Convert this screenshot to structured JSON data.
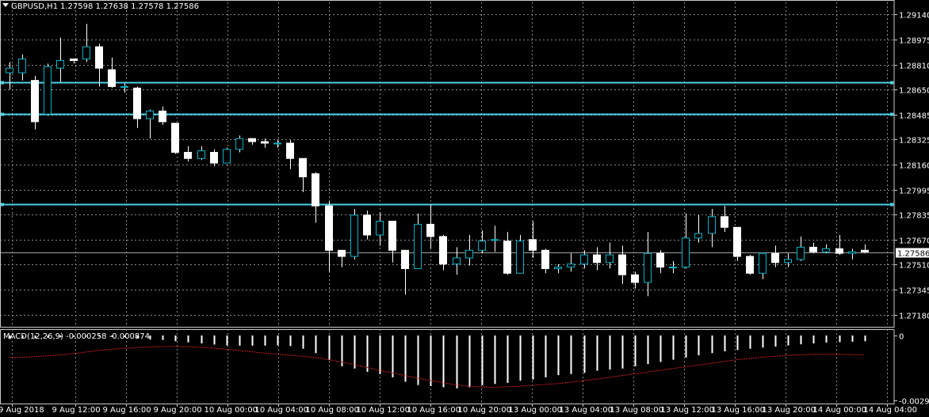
{
  "main_header": {
    "symbol_tf": "GBPUSD,H1",
    "ohlc": "1.27598 1.27638 1.27578 1.27586"
  },
  "macd_header": {
    "label": "MACD(12,26,9) -0.000258 -0.000874"
  },
  "current_price_label": "1.27586",
  "colors": {
    "background": "#000000",
    "bull_outline": "#00b4c8",
    "bear_fill": "#ffffff",
    "wick": "#ffffff",
    "hline": "#4cd2e6",
    "macd_hist": "#ffffff",
    "macd_signal": "#c81e1e",
    "grid": "#8a8a8a",
    "price_tag_bg": "#ffffff"
  },
  "chart_data": [
    {
      "type": "candlestick",
      "title": "GBPUSD,H1",
      "ylim": [
        1.271,
        1.2922
      ],
      "y_ticks": [
        "1.29140",
        "1.28975",
        "1.28810",
        "1.28650",
        "1.28485",
        "1.28325",
        "1.28160",
        "1.27995",
        "1.27835",
        "1.27670",
        "1.27510",
        "1.27345",
        "1.27180"
      ],
      "x_ticks": [
        "9 Aug 2018",
        "9 Aug 12:00",
        "9 Aug 16:00",
        "9 Aug 20:00",
        "10 Aug 00:00",
        "10 Aug 04:00",
        "10 Aug 08:00",
        "10 Aug 12:00",
        "10 Aug 16:00",
        "10 Aug 20:00",
        "13 Aug 00:00",
        "13 Aug 04:00",
        "13 Aug 08:00",
        "13 Aug 12:00",
        "13 Aug 16:00",
        "13 Aug 20:00",
        "14 Aug 00:00",
        "14 Aug 04:00"
      ],
      "horizontal_levels": [
        1.287,
        1.2849,
        1.279
      ],
      "current_price": 1.27586,
      "candles": [
        [
          1.2876,
          1.2879,
          1.2865,
          1.2883
        ],
        [
          1.2876,
          1.2885,
          1.2871,
          1.2888
        ],
        [
          1.2871,
          1.2844,
          1.2839,
          1.2874
        ],
        [
          1.2849,
          1.288,
          1.2848,
          1.2882
        ],
        [
          1.2879,
          1.2884,
          1.287,
          1.2899
        ],
        [
          1.2885,
          1.2884,
          1.2882,
          1.2885
        ],
        [
          1.2885,
          1.2893,
          1.2883,
          1.2908
        ],
        [
          1.2893,
          1.2879,
          1.2867,
          1.2895
        ],
        [
          1.2878,
          1.2867,
          1.2866,
          1.2886
        ],
        [
          1.2867,
          1.2867,
          1.2863,
          1.2869
        ],
        [
          1.2866,
          1.2846,
          1.284,
          1.2867
        ],
        [
          1.2846,
          1.2851,
          1.2833,
          1.2852
        ],
        [
          1.2851,
          1.2844,
          1.2842,
          1.2854
        ],
        [
          1.2843,
          1.2824,
          1.2823,
          1.2843
        ],
        [
          1.2824,
          1.282,
          1.2818,
          1.2828
        ],
        [
          1.282,
          1.2825,
          1.2819,
          1.2828
        ],
        [
          1.2824,
          1.2817,
          1.2815,
          1.2826
        ],
        [
          1.2817,
          1.2826,
          1.2817,
          1.2827
        ],
        [
          1.2826,
          1.2833,
          1.2824,
          1.2835
        ],
        [
          1.2833,
          1.2831,
          1.2829,
          1.2833
        ],
        [
          1.2831,
          1.283,
          1.2827,
          1.2833
        ],
        [
          1.283,
          1.283,
          1.2827,
          1.2832
        ],
        [
          1.283,
          1.282,
          1.2813,
          1.2832
        ],
        [
          1.282,
          1.2808,
          1.2798,
          1.282
        ],
        [
          1.281,
          1.2789,
          1.2778,
          1.2811
        ],
        [
          1.2789,
          1.276,
          1.2746,
          1.2792
        ],
        [
          1.276,
          1.2756,
          1.2749,
          1.276
        ],
        [
          1.2756,
          1.2783,
          1.2754,
          1.2787
        ],
        [
          1.2783,
          1.277,
          1.2767,
          1.2786
        ],
        [
          1.277,
          1.2779,
          1.2763,
          1.2785
        ],
        [
          1.2779,
          1.276,
          1.2752,
          1.2779
        ],
        [
          1.276,
          1.2748,
          1.2731,
          1.276
        ],
        [
          1.2748,
          1.2777,
          1.2748,
          1.2784
        ],
        [
          1.2777,
          1.2769,
          1.2761,
          1.279
        ],
        [
          1.2769,
          1.2751,
          1.2747,
          1.277
        ],
        [
          1.2751,
          1.2755,
          1.2744,
          1.2762
        ],
        [
          1.2755,
          1.276,
          1.275,
          1.277
        ],
        [
          1.276,
          1.2766,
          1.2758,
          1.2773
        ],
        [
          1.2767,
          1.2767,
          1.2759,
          1.2776
        ],
        [
          1.2766,
          1.2745,
          1.2744,
          1.2772
        ],
        [
          1.2745,
          1.2766,
          1.2745,
          1.277
        ],
        [
          1.2767,
          1.276,
          1.2755,
          1.2779
        ],
        [
          1.276,
          1.2748,
          1.2745,
          1.2761
        ],
        [
          1.2748,
          1.2749,
          1.2745,
          1.2751
        ],
        [
          1.2749,
          1.2751,
          1.2746,
          1.2758
        ],
        [
          1.2751,
          1.2757,
          1.2748,
          1.276
        ],
        [
          1.2757,
          1.2752,
          1.2747,
          1.2762
        ],
        [
          1.2752,
          1.2757,
          1.2748,
          1.2765
        ],
        [
          1.2757,
          1.2744,
          1.2738,
          1.2763
        ],
        [
          1.2744,
          1.2739,
          1.2735,
          1.2746
        ],
        [
          1.2739,
          1.2758,
          1.273,
          1.2772
        ],
        [
          1.2758,
          1.2749,
          1.2745,
          1.276
        ],
        [
          1.2749,
          1.2749,
          1.2745,
          1.2753
        ],
        [
          1.2749,
          1.2768,
          1.2748,
          1.2784
        ],
        [
          1.2768,
          1.2771,
          1.2765,
          1.2783
        ],
        [
          1.2771,
          1.2782,
          1.2762,
          1.2787
        ],
        [
          1.2782,
          1.2775,
          1.2772,
          1.2789
        ],
        [
          1.2775,
          1.2756,
          1.2753,
          1.2775
        ],
        [
          1.2756,
          1.2745,
          1.2744,
          1.2757
        ],
        [
          1.2745,
          1.2758,
          1.2741,
          1.2758
        ],
        [
          1.2758,
          1.2752,
          1.2749,
          1.2763
        ],
        [
          1.2752,
          1.2754,
          1.2749,
          1.2758
        ],
        [
          1.2754,
          1.2762,
          1.2753,
          1.2769
        ],
        [
          1.2762,
          1.2759,
          1.2758,
          1.2765
        ],
        [
          1.2759,
          1.2761,
          1.2758,
          1.2764
        ],
        [
          1.2761,
          1.2758,
          1.2757,
          1.277
        ],
        [
          1.2758,
          1.2759,
          1.2754,
          1.2761
        ],
        [
          1.276,
          1.2759,
          1.2758,
          1.2764
        ]
      ]
    },
    {
      "type": "bar",
      "title": "MACD(12,26,9) -0.000258 -0.000874",
      "ylim": [
        -0.002947,
        0
      ],
      "y_ticks": [
        "0",
        "-0.002947"
      ],
      "values": [
        -0.00015,
        -0.00013,
        -0.00012,
        -0.0001,
        -8e-05,
        -6e-05,
        -5e-05,
        -5e-05,
        -6e-05,
        -8e-05,
        -0.00012,
        -0.00018,
        -0.0002,
        -0.00026,
        -0.00031,
        -0.00036,
        -0.00041,
        -0.00045,
        -0.00046,
        -0.00046,
        -0.00046,
        -0.00045,
        -0.00048,
        -0.0006,
        -0.0008,
        -0.0011,
        -0.0014,
        -0.0015,
        -0.00165,
        -0.00175,
        -0.0019,
        -0.0021,
        -0.00225,
        -0.0023,
        -0.00235,
        -0.0024,
        -0.00235,
        -0.00225,
        -0.0022,
        -0.00215,
        -0.00205,
        -0.002,
        -0.0019,
        -0.0018,
        -0.00175,
        -0.0017,
        -0.0016,
        -0.00155,
        -0.0015,
        -0.0014,
        -0.0013,
        -0.0012,
        -0.0011,
        -0.001,
        -0.0009,
        -0.0008,
        -0.00072,
        -0.00066,
        -0.0006,
        -0.00055,
        -0.0005,
        -0.00045,
        -0.0004,
        -0.00036,
        -0.00032,
        -0.0003,
        -0.00028,
        -0.00026
      ],
      "signal": [
        -0.001,
        -0.00099,
        -0.00096,
        -0.00092,
        -0.00088,
        -0.00082,
        -0.00075,
        -0.00068,
        -0.00062,
        -0.00058,
        -0.00055,
        -0.00052,
        -0.0005,
        -0.0005,
        -0.00051,
        -0.00054,
        -0.00058,
        -0.00063,
        -0.00068,
        -0.00074,
        -0.0008,
        -0.00085,
        -0.0009,
        -0.00095,
        -0.001,
        -0.0011,
        -0.0012,
        -0.00132,
        -0.00145,
        -0.00158,
        -0.0017,
        -0.00182,
        -0.00194,
        -0.00205,
        -0.00215,
        -0.00224,
        -0.00231,
        -0.00234,
        -0.00235,
        -0.00233,
        -0.0023,
        -0.00226,
        -0.00222,
        -0.00218,
        -0.00212,
        -0.00205,
        -0.00198,
        -0.0019,
        -0.00182,
        -0.00174,
        -0.00166,
        -0.00158,
        -0.0015,
        -0.00142,
        -0.00134,
        -0.00126,
        -0.00118,
        -0.0011,
        -0.00104,
        -0.00098,
        -0.00094,
        -0.0009,
        -0.00088,
        -0.00086,
        -0.00085,
        -0.00086,
        -0.00087,
        -0.00087
      ]
    }
  ]
}
